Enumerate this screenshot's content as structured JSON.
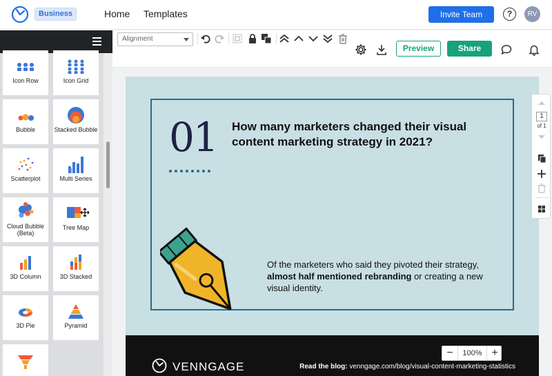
{
  "topnav": {
    "badge": "Business",
    "links": [
      "Home",
      "Templates"
    ],
    "invite_label": "Invite Team",
    "help": "?",
    "avatar": "RV"
  },
  "sidebar": {
    "tiles": [
      {
        "label": "Icon Row",
        "icon": "icon-row-icon"
      },
      {
        "label": "Icon Grid",
        "icon": "icon-grid-icon"
      },
      {
        "label": "Bubble",
        "icon": "bubble-icon"
      },
      {
        "label": "Stacked Bubble",
        "icon": "stacked-bubble-icon"
      },
      {
        "label": "Scatterplot",
        "icon": "scatterplot-icon"
      },
      {
        "label": "Multi Series",
        "icon": "multi-series-icon"
      },
      {
        "label": "Cloud Bubble (Beta)",
        "icon": "cloud-bubble-icon"
      },
      {
        "label": "Tree Map",
        "icon": "tree-map-icon"
      },
      {
        "label": "3D Column",
        "icon": "3d-column-icon"
      },
      {
        "label": "3D Stacked",
        "icon": "3d-stacked-icon"
      },
      {
        "label": "3D Pie",
        "icon": "3d-pie-icon"
      },
      {
        "label": "Pyramid",
        "icon": "pyramid-icon"
      },
      {
        "label": "",
        "icon": "funnel-icon"
      }
    ]
  },
  "toolbar": {
    "alignment": "Alignment",
    "preview_label": "Preview",
    "share_label": "Share"
  },
  "design": {
    "number": "01",
    "question": "How many marketers changed their visual content marketing strategy in 2021?",
    "answer_pre": "Of the marketers who said they pivoted their strategy, ",
    "answer_bold": "almost half mentioned rebranding",
    "answer_post": " or creating a new visual identity.",
    "brand": "VENNGAGE",
    "blog_label": "Read the blog:",
    "blog_url": " venngage.com/blog/visual-content-marketing-statistics",
    "colors": {
      "background": "#c8dfe3",
      "frame": "#2a6a8e",
      "number": "#1c2346",
      "pen_body": "#f0b429",
      "pen_cap": "#3aa38f"
    }
  },
  "zoom": {
    "value": "100%",
    "minus": "−",
    "plus": "+"
  },
  "pagetools": {
    "page": "1",
    "of": "of 1"
  },
  "colors": {
    "accent": "#16a37b",
    "primary": "#1f6fe8"
  }
}
